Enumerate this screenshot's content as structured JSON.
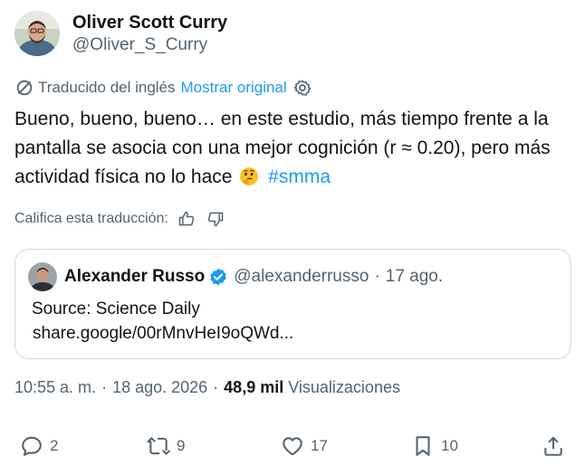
{
  "author": {
    "name": "Oliver Scott Curry",
    "handle": "@Oliver_S_Curry"
  },
  "translation": {
    "label": "Traducido del inglés",
    "show_original": "Mostrar original"
  },
  "tweet": {
    "text_main": "Bueno, bueno, bueno… en este estudio, más tiempo frente a la pantalla se asocia con una mejor cognición (r ≈ 0.20), pero más actividad física no lo hace",
    "emoji": "thinking-face",
    "hashtag": "#smma"
  },
  "rate": {
    "label": "Califica esta traducción:"
  },
  "quote": {
    "name": "Alexander Russo",
    "handle": "@alexanderrusso",
    "date": "17 ago.",
    "line1": "Source: Science Daily",
    "line2": "share.google/00rMnvHeI9oQWd..."
  },
  "meta": {
    "time": "10:55 a. m.",
    "date": "18 ago. 2026",
    "views_count": "48,9 mil",
    "views_label": "Visualizaciones"
  },
  "actions": {
    "replies": "2",
    "reposts": "9",
    "likes": "17",
    "bookmarks": "10"
  },
  "colors": {
    "accent": "#1d9bf0",
    "muted": "#536471",
    "text": "#0f1419",
    "border": "#cfd9de"
  }
}
